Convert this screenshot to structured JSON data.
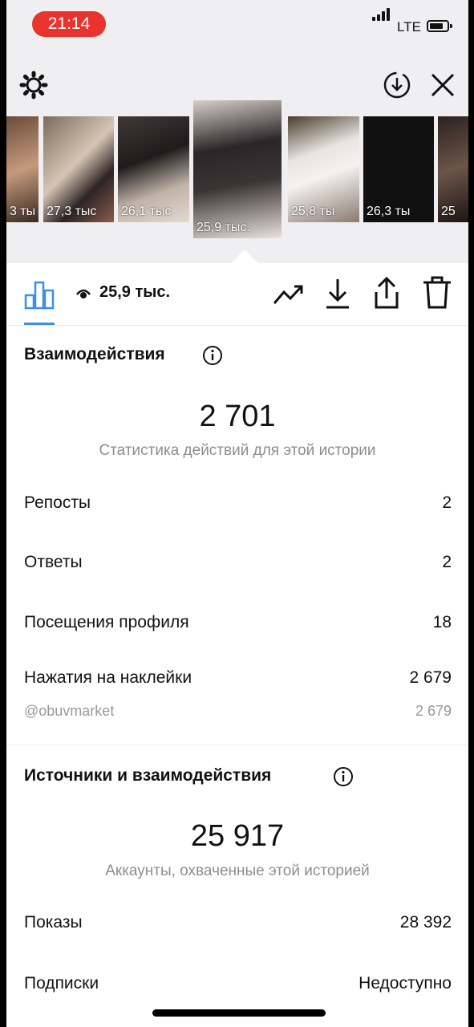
{
  "status_bar": {
    "time": "21:14",
    "network": "LTE"
  },
  "thumbnails": [
    {
      "views": "3 ты"
    },
    {
      "views": "27,3 тыс"
    },
    {
      "views": "26,1 тыс"
    },
    {
      "views": "25,9 тыс.",
      "selected": true
    },
    {
      "views": "25,8 ты"
    },
    {
      "views": "26,3 ты"
    },
    {
      "views": "25"
    }
  ],
  "toolbar": {
    "views": "25,9 тыс."
  },
  "interactions": {
    "title": "Взаимодействия",
    "total": "2 701",
    "caption": "Статистика действий для этой истории",
    "rows": [
      {
        "label": "Репосты",
        "value": "2"
      },
      {
        "label": "Ответы",
        "value": "2"
      },
      {
        "label": "Посещения профиля",
        "value": "18"
      },
      {
        "label": "Нажатия на наклейки",
        "value": "2 679"
      }
    ],
    "sticker_sub": {
      "label": "@obuvmarket",
      "value": "2 679"
    }
  },
  "discovery": {
    "title": "Источники и взаимодействия",
    "total": "25 917",
    "caption": "Аккаунты, охваченные этой историей",
    "rows": [
      {
        "label": "Показы",
        "value": "28 392"
      },
      {
        "label": "Подписки",
        "value": "Недоступно"
      }
    ]
  },
  "colors": {
    "accent": "#3b8fe8",
    "time_pill": "#e8332f"
  }
}
